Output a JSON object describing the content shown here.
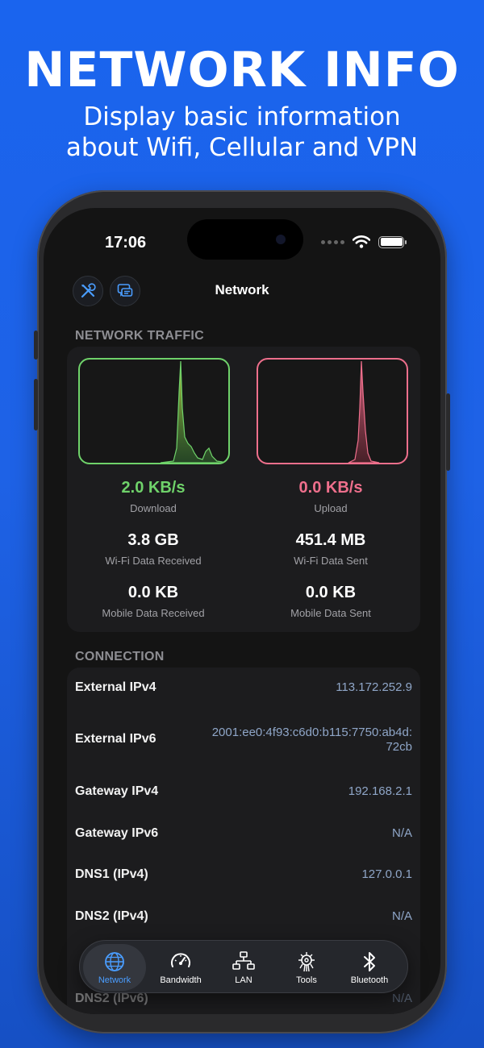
{
  "promo": {
    "title": "NETWORK INFO",
    "subtitle_line1": "Display basic information",
    "subtitle_line2": "about Wifi, Cellular and VPN"
  },
  "status_bar": {
    "time": "17:06"
  },
  "nav": {
    "title": "Network",
    "left_icons": [
      "tools-icon",
      "chat-icon"
    ]
  },
  "traffic": {
    "header": "NETWORK TRAFFIC",
    "download": {
      "value": "2.0 KB/s",
      "label": "Download"
    },
    "upload": {
      "value": "0.0 KB/s",
      "label": "Upload"
    },
    "wifi_received": {
      "value": "3.8 GB",
      "label": "Wi-Fi Data Received"
    },
    "wifi_sent": {
      "value": "451.4 MB",
      "label": "Wi-Fi Data Sent"
    },
    "mobile_received": {
      "value": "0.0 KB",
      "label": "Mobile Data Received"
    },
    "mobile_sent": {
      "value": "0.0 KB",
      "label": "Mobile Data Sent"
    },
    "colors": {
      "download": "#6fd26a",
      "upload": "#ee6f8c"
    }
  },
  "connection": {
    "header": "CONNECTION",
    "rows": [
      {
        "label": "External IPv4",
        "value": "113.172.252.9"
      },
      {
        "label": "External IPv6",
        "value_line1": "2001:ee0:4f93:c6d0:b115:7750:ab4d:",
        "value_line2": "72cb"
      },
      {
        "label": "Gateway IPv4",
        "value": "192.168.2.1"
      },
      {
        "label": "Gateway IPv6",
        "value": "N/A"
      },
      {
        "label": "DNS1 (IPv4)",
        "value": "127.0.0.1"
      },
      {
        "label": "DNS2 (IPv4)",
        "value": "N/A"
      },
      {
        "label": "DNS2 (IPv6)",
        "value": "N/A"
      }
    ]
  },
  "tabbar": {
    "active": "Network",
    "tabs": [
      {
        "label": "Network",
        "icon": "globe-icon"
      },
      {
        "label": "Bandwidth",
        "icon": "speedometer-icon"
      },
      {
        "label": "LAN",
        "icon": "lan-icon"
      },
      {
        "label": "Tools",
        "icon": "chip-icon"
      },
      {
        "label": "Bluetooth",
        "icon": "bluetooth-icon"
      }
    ]
  },
  "accent": "#4a9dff"
}
